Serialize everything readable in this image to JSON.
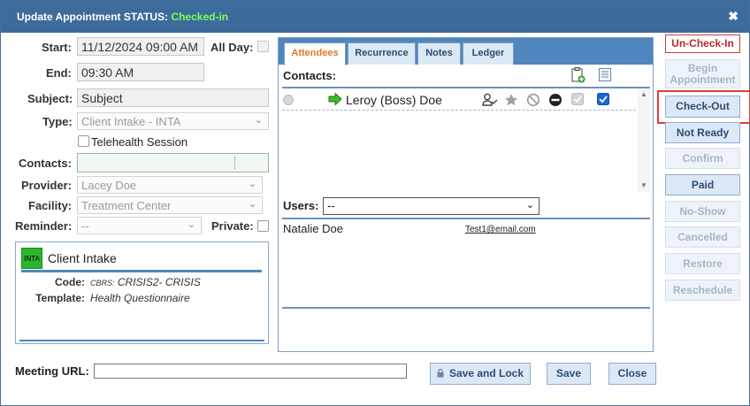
{
  "dialog": {
    "title": "Update Appointment STATUS:",
    "status": "Checked-in",
    "close": "✖"
  },
  "form": {
    "start_label": "Start:",
    "start_value": "11/12/2024 09:00 AM",
    "allday_label": "All Day:",
    "end_label": "End:",
    "end_value": "09:30 AM",
    "subject_label": "Subject:",
    "subject_value": "Subject",
    "type_label": "Type:",
    "type_value": "Client Intake - INTA",
    "telehealth_label": "Telehealth Session",
    "contacts_label": "Contacts:",
    "provider_label": "Provider:",
    "provider_value": "Lacey Doe",
    "facility_label": "Facility:",
    "facility_value": "Treatment Center",
    "reminder_label": "Reminder:",
    "reminder_value": "--",
    "private_label": "Private:"
  },
  "info": {
    "badge": "INTA",
    "title": "Client Intake",
    "code_label": "Code:",
    "code_prefix": "CBRS:",
    "code_value": "CRISIS2- CRISIS",
    "template_label": "Template:",
    "template_value": "Health Questionnaire"
  },
  "tabs": [
    "Attendees",
    "Recurrence",
    "Notes",
    "Ledger"
  ],
  "contacts": {
    "label": "Contacts:",
    "name": "Leroy (Boss) Doe"
  },
  "users": {
    "label": "Users:",
    "selected": "--",
    "name": "Natalie Doe",
    "email": "Test1@email.com"
  },
  "side_buttons": {
    "uncheck": "Un-Check-In",
    "begin": "Begin Appointment",
    "checkout": "Check-Out",
    "notready": "Not Ready",
    "confirm": "Confirm",
    "paid": "Paid",
    "noshow": "No-Show",
    "cancelled": "Cancelled",
    "restore": "Restore",
    "reschedule": "Reschedule"
  },
  "footer": {
    "url_label": "Meeting URL:",
    "url_value": "",
    "save_lock": "Save and Lock",
    "save": "Save",
    "close": "Close"
  },
  "colors": {
    "titlebar": "#3d6b9c",
    "status": "#7dff57",
    "accent": "#4f86bd",
    "highlight": "#e23c3c"
  }
}
